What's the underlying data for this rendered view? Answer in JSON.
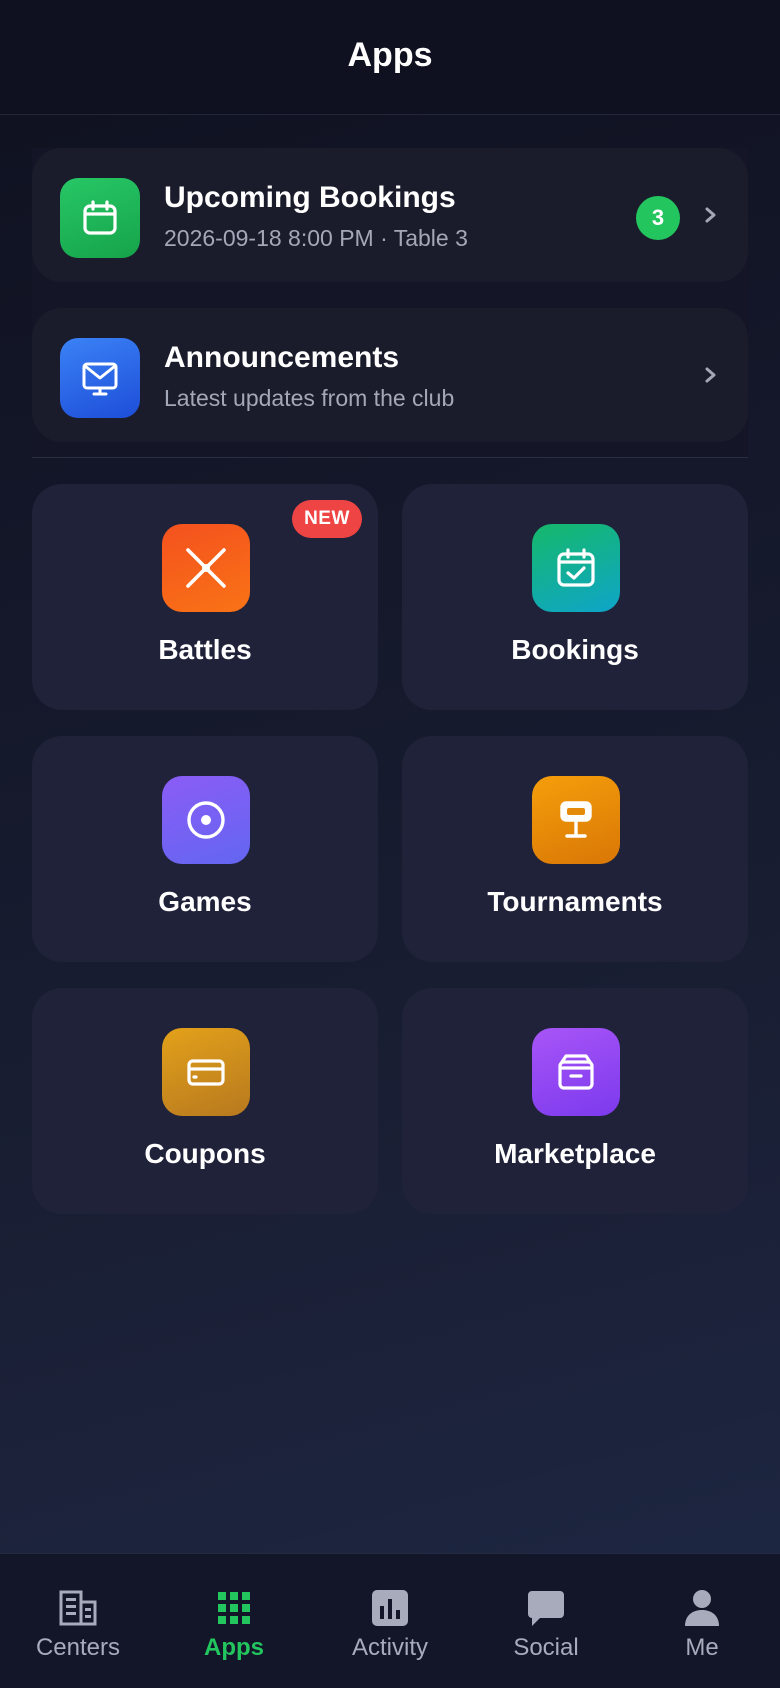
{
  "header": {
    "title": "Apps"
  },
  "list": [
    {
      "title": "Upcoming Bookings",
      "subtitle": "2026-09-18 8:00 PM · Table 3",
      "badge": "3",
      "icon": "calendar-icon",
      "color": "#22c55e"
    },
    {
      "title": "Announcements",
      "subtitle": "Latest updates from the club",
      "icon": "mail-icon",
      "color": "#2563eb"
    }
  ],
  "tiles": [
    {
      "label": "Battles",
      "icon": "crossed-swords-icon",
      "badge": "NEW",
      "color": "#f05a2b"
    },
    {
      "label": "Bookings",
      "icon": "calendar-check-icon",
      "color": "#10b981"
    },
    {
      "label": "Games",
      "icon": "target-icon",
      "color": "#7c5cf6"
    },
    {
      "label": "Tournaments",
      "icon": "trophy-icon",
      "color": "#f59e0b"
    },
    {
      "label": "Coupons",
      "icon": "card-icon",
      "color": "#d99014"
    },
    {
      "label": "Marketplace",
      "icon": "archive-box-icon",
      "color": "#9b4cf0"
    }
  ],
  "tabs": [
    {
      "label": "Centers",
      "icon": "building-icon",
      "active": false
    },
    {
      "label": "Apps",
      "icon": "grid-icon",
      "active": true
    },
    {
      "label": "Activity",
      "icon": "bar-chart-icon",
      "active": false
    },
    {
      "label": "Social",
      "icon": "chat-bubble-icon",
      "active": false
    },
    {
      "label": "Me",
      "icon": "person-icon",
      "active": false
    }
  ],
  "colors": {
    "accent": "#22c55e",
    "background": "#0f1120",
    "card": "#1a1c2c",
    "tile": "#20223a",
    "badge_new": "#ef4444"
  }
}
